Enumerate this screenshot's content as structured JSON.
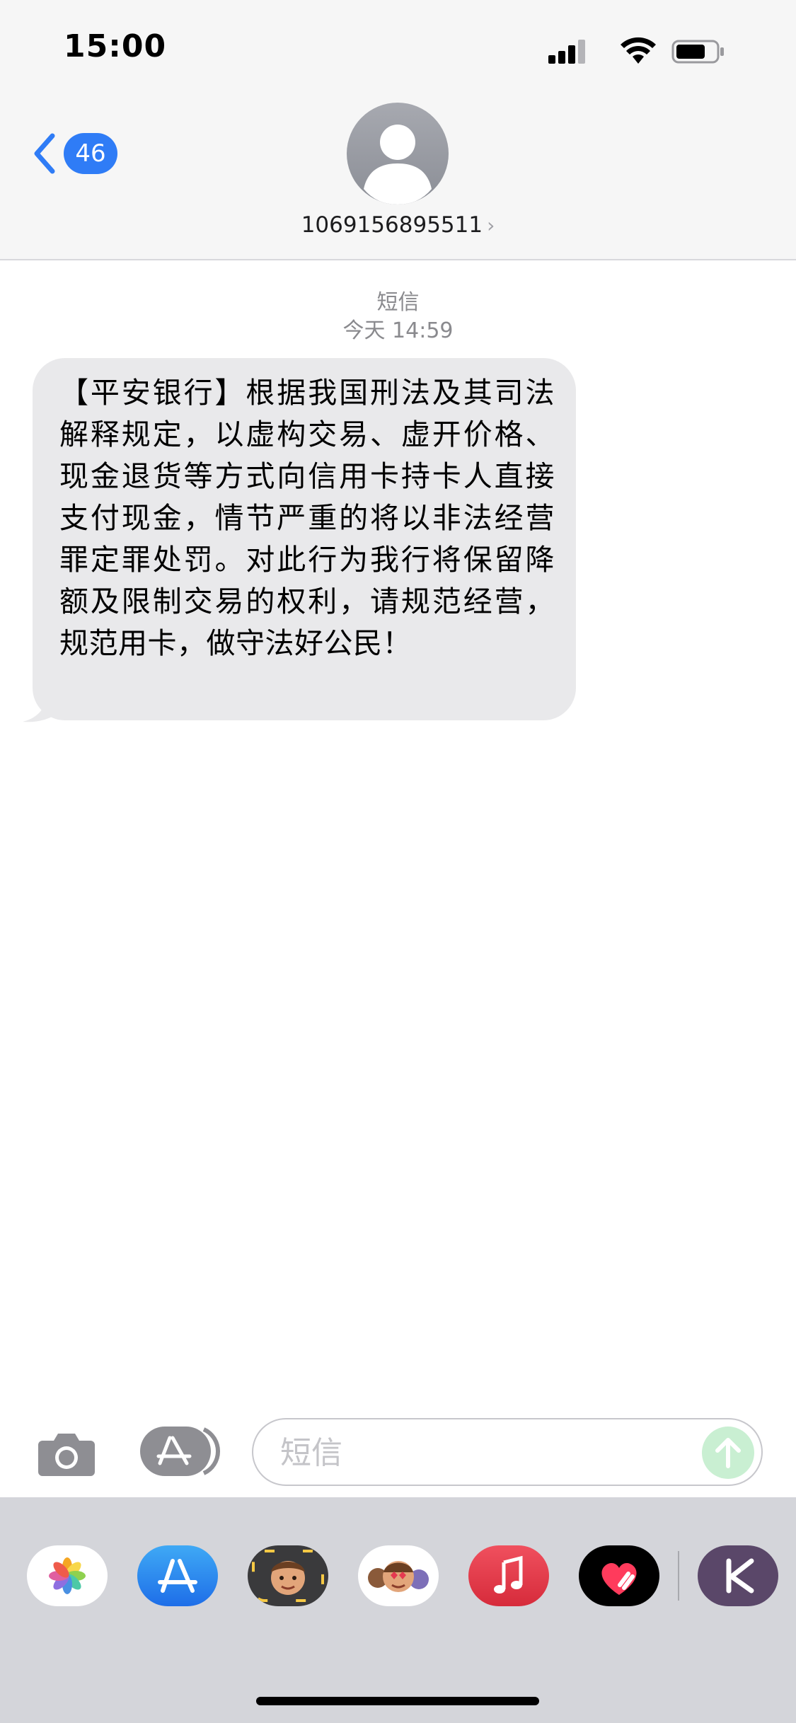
{
  "status_bar": {
    "time": "15:00"
  },
  "nav": {
    "back_badge": "46",
    "contact_number": "1069156895511",
    "contact_chevron": "›"
  },
  "thread": {
    "service_label": "短信",
    "timestamp": "今天 14:59",
    "messages": [
      {
        "direction": "incoming",
        "text": "【平安银行】根据我国刑法及其司法解释规定，以虚构交易、虚开价格、现金退货等方式向信用卡持卡人直接支付现金，情节严重的将以非法经营罪定罪处罚。对此行为我行将保留降额及限制交易的权利，请规范经营，规范用卡，做守法好公民！"
      }
    ]
  },
  "composer": {
    "placeholder": "短信"
  },
  "app_tray": {
    "apps": [
      "photos-app",
      "app-store-app",
      "memoji-sticker-app",
      "animoji-app",
      "music-app",
      "digital-touch-app",
      "keep-app"
    ]
  },
  "colors": {
    "accent_blue": "#2f7cf6",
    "bubble_gray": "#e9e9eb",
    "header_bg": "#f6f6f6",
    "tray_bg": "#d4d5da",
    "send_green_disabled": "#c9efd2"
  }
}
